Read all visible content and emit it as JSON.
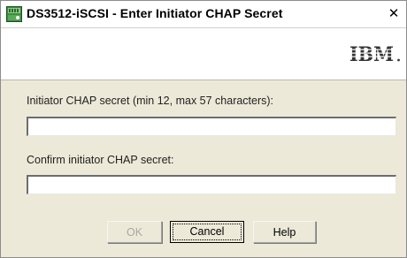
{
  "window": {
    "title": "DS3512-iSCSI - Enter Initiator CHAP Secret",
    "close_glyph": "✕"
  },
  "branding": {
    "logo_text": "IBM",
    "logo_color": "#333333"
  },
  "form": {
    "secret_label": "Initiator CHAP secret (min 12, max 57 characters):",
    "secret_value": "",
    "confirm_label": "Confirm initiator CHAP secret:",
    "confirm_value": ""
  },
  "buttons": {
    "ok_label": "OK",
    "cancel_label": "Cancel",
    "help_label": "Help"
  },
  "icons": {
    "app": "storage-manager-app-icon",
    "close": "close-icon",
    "logo": "ibm-logo"
  }
}
